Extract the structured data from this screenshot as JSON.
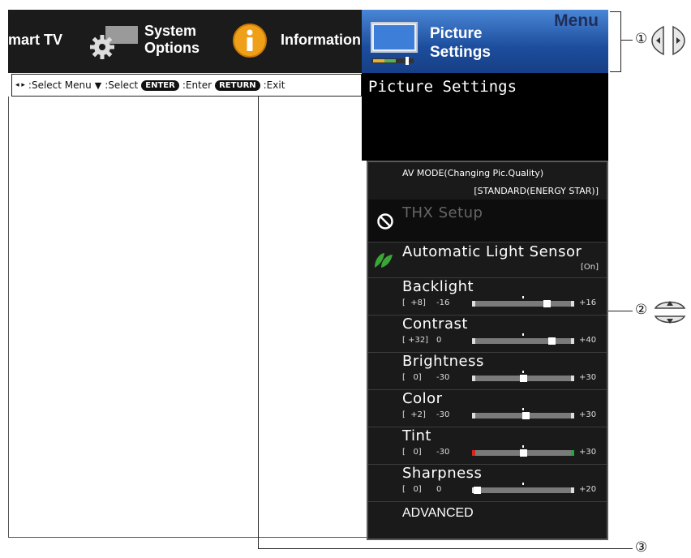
{
  "top_menu": {
    "smart_tv": "mart TV",
    "system_options_line1": "System",
    "system_options_line2": "Options",
    "information": "Information"
  },
  "picture_tab": {
    "menu_word": "Menu",
    "label_line1": "Picture",
    "label_line2": "Settings"
  },
  "key_guide": {
    "select_menu": ":Select Menu",
    "select": ":Select",
    "enter_key": "ENTER",
    "enter": ":Enter",
    "return_key": "RETURN",
    "exit": ":Exit"
  },
  "panel_title": "Picture Settings",
  "av_mode": {
    "line1": "AV MODE(Changing Pic.Quality)",
    "line2": "[STANDARD(ENERGY STAR)]"
  },
  "items": {
    "thx": "THX Setup",
    "light_sensor": "Automatic Light Sensor",
    "light_sensor_value": "[On]",
    "advanced": "ADVANCED"
  },
  "sliders": [
    {
      "label": "Backlight",
      "current": "[  +8]",
      "min": "-16",
      "max": "+16",
      "level": 0.75
    },
    {
      "label": "Contrast",
      "current": "[ +32]",
      "min": "0",
      "max": "+40",
      "level": 0.8
    },
    {
      "label": "Brightness",
      "current": "[   0]",
      "min": "-30",
      "max": "+30",
      "level": 0.5
    },
    {
      "label": "Color",
      "current": "[  +2]",
      "min": "-30",
      "max": "+30",
      "level": 0.53
    },
    {
      "label": "Tint",
      "current": "[   0]",
      "min": "-30",
      "max": "+30",
      "level": 0.5
    },
    {
      "label": "Sharpness",
      "current": "[   0]",
      "min": "0",
      "max": "+20",
      "level": 0.0
    }
  ],
  "callouts": {
    "one": "①",
    "two": "②",
    "three": "③"
  },
  "colors": {
    "tab_blue": "#1c4d9c",
    "leaf_green": "#3aa635",
    "info_orange": "#f0a018",
    "tint_red": "#d8241c",
    "tint_green": "#23a83a"
  }
}
